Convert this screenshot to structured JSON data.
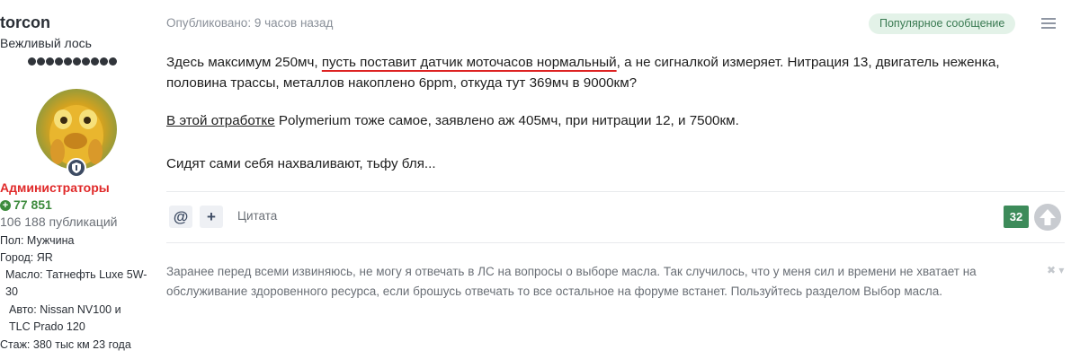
{
  "author": {
    "username": "torcon",
    "title": "Вежливый лось",
    "group": "Администраторы",
    "reputation": "77 851",
    "post_count": "106 188 публикаций",
    "fields": [
      {
        "label": "Пол:",
        "value": "Мужчина"
      },
      {
        "label": "Город:",
        "value": "ЯR"
      },
      {
        "label": "Масло:",
        "value": "Татнефть Luxe 5W-30"
      },
      {
        "label": "Авто:",
        "value": "Nissan NV100 и TLC Prado 120"
      },
      {
        "label": "Стаж:",
        "value": "380 тыс км 23 года"
      }
    ]
  },
  "post": {
    "published": "Опубликовано: 9 часов назад",
    "popular_badge": "Популярное сообщение",
    "p1_start": "Здесь максимум 250мч, ",
    "p1_underlined": "пусть поставит датчик моточасов нормальный",
    "p1_end": ", а не сигналкой измеряет. Нитрация 13, двигатель неженка, половина трассы, металлов накоплено 6ppm, откуда тут 369мч в 9000км?",
    "p2_link": "В этой отработке",
    "p2_text": " Polymerium тоже самое, заявлено аж 405мч, при нитрации 12, и 7500км.",
    "p3": "Сидят сами себя нахваливают, тьфу бля...",
    "mention_icon": "@",
    "add_icon": "+",
    "quote_label": "Цитата",
    "votes": "32"
  },
  "signature": {
    "text": "Заранее перед всеми извиняюсь, не могу я отвечать в ЛС на вопросы о выборе масла. Так случилось, что у меня сил и времени не хватает на обслуживание здоровенного ресурса, если брошусь отвечать то все остальное на форуме встанет. Пользуйтесь разделом Выбор масла.",
    "controls": "✖ ▾"
  },
  "colors": {
    "group": "#e02929",
    "reputation": "#3d8b3d",
    "votes_bg": "#3d8b5a",
    "popular_bg": "#e3f2e8",
    "underline": "#dd2222"
  }
}
